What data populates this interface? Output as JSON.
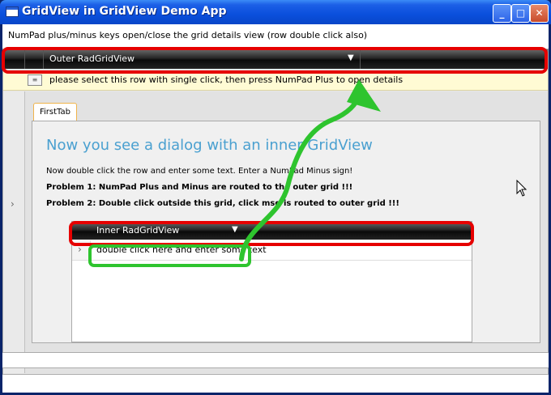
{
  "window": {
    "title": "GridView in GridView Demo App",
    "minimize_symbol": "_",
    "maximize_symbol": "□",
    "close_symbol": "✕"
  },
  "hint_text": "NumPad plus/minus keys open/close the grid details view (row double click also)",
  "outer_grid": {
    "column_header": "Outer RadGridView",
    "filter_icon": "filter-icon",
    "row_text": "please select this row with single click, then press NumPad Plus to open details",
    "row_indicator_symbol": "≡"
  },
  "details": {
    "tab_label": "FirstTab",
    "dialog_title": "Now you see a dialog with an inner GridView",
    "instruction": "Now double click the  row and enter some text. Enter a NumPad Minus sign!",
    "problem1": "Problem 1: NumPad Plus and Minus are routed to the outer grid !!!",
    "problem2": "Problem 2: Double click outside this grid, click msg is routed to outer grid !!!"
  },
  "inner_grid": {
    "column_header": "Inner RadGridView",
    "cell_text": "double click here and enter some text"
  },
  "chevron_symbol": "›",
  "colors": {
    "highlight_red": "#e60000",
    "highlight_green": "#2ec42e",
    "title_accent": "#4aa0d0",
    "selected_row": "#fffbd4"
  }
}
